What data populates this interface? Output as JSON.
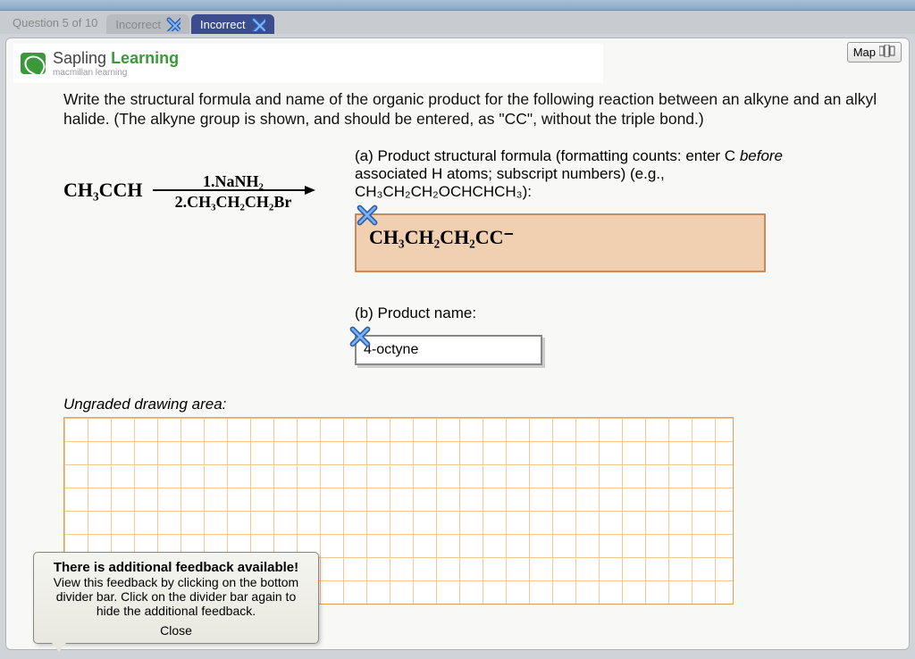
{
  "header": {
    "question_label": "Question 5 of 10",
    "tab_inactive": "Incorrect",
    "tab_active": "Incorrect"
  },
  "map_button": "Map",
  "brand": {
    "line1_a": "Sapling ",
    "line1_b": "Learning",
    "line2": "macmillan learning"
  },
  "question_text": "Write the structural formula and name of the organic product for the following reaction between an alkyne and an alkyl halide. (The alkyne group is shown, and should be entered, as \"CC\", without the triple bond.)",
  "reaction": {
    "reactant": "CH₃CCH",
    "reagent1": "1.NaNH₂",
    "reagent2": "2.CH₃CH₂CH₂Br"
  },
  "part_a": {
    "label_pre": "(a) Product structural formula (formatting counts: enter C ",
    "label_ital": "before",
    "label_post": " associated H atoms; subscript numbers) (e.g., CH₃CH₂CH₂OCHCHCH₃):",
    "answer": "CH₃CH₂CH₂CC⁻"
  },
  "part_b": {
    "label": "(b) Product name:",
    "answer": "4-octyne"
  },
  "ungraded_label": "Ungraded drawing area:",
  "feedback": {
    "heading": "There is additional feedback available!",
    "body": "View this feedback by clicking on the bottom divider bar. Click on the divider bar again to hide the additional feedback.",
    "close": "Close"
  }
}
